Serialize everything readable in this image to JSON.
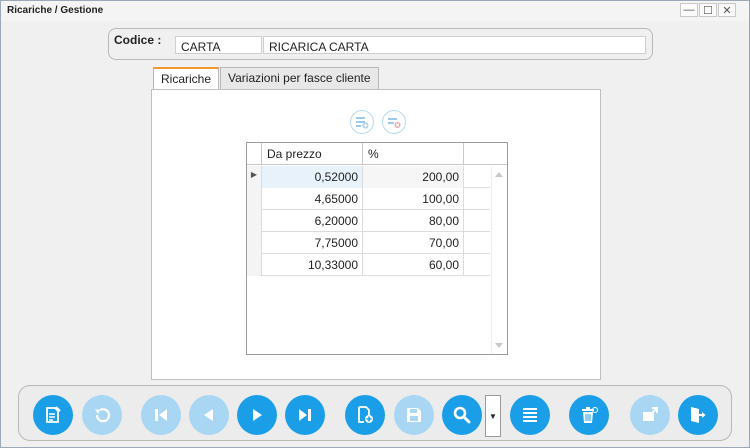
{
  "window": {
    "title": "Ricariche / Gestione",
    "controls": {
      "minimize": "—",
      "maximize": "☐",
      "close": "✕"
    }
  },
  "header": {
    "codice_label": "Codice :",
    "code_value": "CARTA",
    "description_value": "RICARICA CARTA"
  },
  "tabs": [
    {
      "label": "Ricariche",
      "active": true
    },
    {
      "label": "Variazioni per fasce cliente",
      "active": false
    }
  ],
  "grid": {
    "columns": [
      "Da prezzo",
      "%"
    ],
    "rows": [
      {
        "indicator": "▶",
        "da_prezzo": "0,52000",
        "percent": "200,00"
      },
      {
        "indicator": "",
        "da_prezzo": "4,65000",
        "percent": "100,00"
      },
      {
        "indicator": "",
        "da_prezzo": "6,20000",
        "percent": "80,00"
      },
      {
        "indicator": "",
        "da_prezzo": "7,75000",
        "percent": "70,00"
      },
      {
        "indicator": "",
        "da_prezzo": "10,33000",
        "percent": "60,00"
      }
    ]
  },
  "grid_actions": [
    {
      "icon": "add-row-icon",
      "enabled": false
    },
    {
      "icon": "delete-row-icon",
      "enabled": false
    }
  ],
  "toolbar": [
    {
      "icon": "edit-document-icon",
      "enabled": true
    },
    {
      "icon": "undo-icon",
      "enabled": false
    },
    {
      "icon": "first-record-icon",
      "enabled": false
    },
    {
      "icon": "previous-record-icon",
      "enabled": false
    },
    {
      "icon": "next-record-icon",
      "enabled": true
    },
    {
      "icon": "last-record-icon",
      "enabled": true
    },
    {
      "icon": "new-document-icon",
      "enabled": true
    },
    {
      "icon": "save-icon",
      "enabled": false
    },
    {
      "icon": "search-icon",
      "enabled": true
    },
    {
      "icon": "search-options-dropdown",
      "enabled": true
    },
    {
      "icon": "list-icon",
      "enabled": true
    },
    {
      "icon": "delete-icon",
      "enabled": true
    },
    {
      "icon": "export-icon",
      "enabled": false
    },
    {
      "icon": "exit-icon",
      "enabled": true
    }
  ],
  "colors": {
    "accent": "#1a9ee8",
    "accent_disabled": "#a9d6f3",
    "active_tab_marker": "#f29a2e"
  }
}
